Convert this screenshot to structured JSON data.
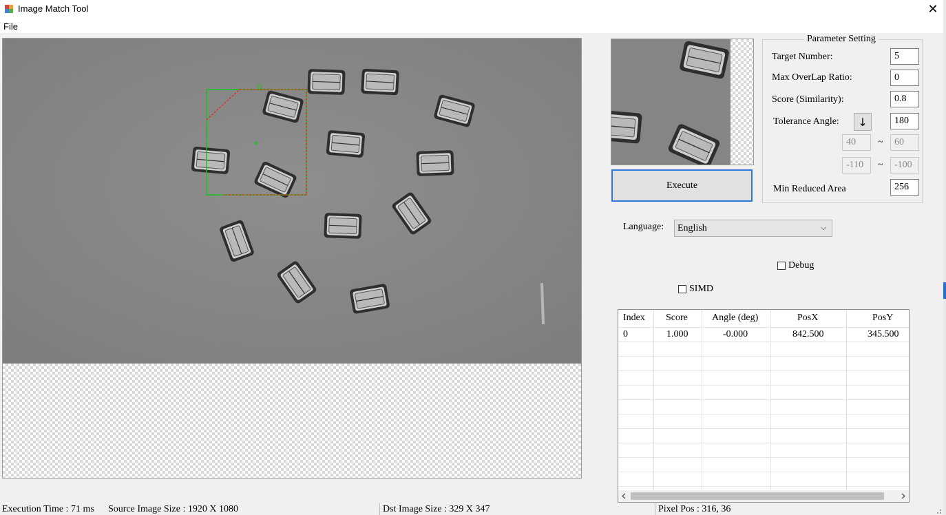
{
  "window": {
    "title": "Image Match Tool"
  },
  "menu": {
    "file": "File"
  },
  "parameters": {
    "group_title": "Parameter Setting",
    "target_number": {
      "label": "Target Number:",
      "value": "5"
    },
    "max_overlap": {
      "label": "Max OverLap Ratio:",
      "value": "0"
    },
    "score": {
      "label": "Score (Similarity):",
      "value": "0.8"
    },
    "tolerance_angle": {
      "label": "Tolerance Angle:",
      "value": "180"
    },
    "range1": {
      "min": "40",
      "max": "60"
    },
    "range2": {
      "min": "-110",
      "max": "-100"
    },
    "min_reduced_area": {
      "label": "Min Reduced Area",
      "value": "256"
    },
    "tilde": "~"
  },
  "execute": "Execute",
  "language": {
    "label": "Language:",
    "selected": "English"
  },
  "debug": "Debug",
  "simd": "SIMD",
  "results": {
    "headers": [
      "Index",
      "Score",
      "Angle (deg)",
      "PosX",
      "PosY"
    ],
    "rows": [
      [
        "0",
        "1.000",
        "-0.000",
        "842.500",
        "345.500"
      ]
    ]
  },
  "status": {
    "execution_time": "Execution Time : 71 ms",
    "source_size": "Source Image Size : 1920 X 1080",
    "dst_size": "Dst Image Size : 329 X 347",
    "pixel_pos": "Pixel Pos : 316, 36"
  },
  "icons": {
    "arrow": "↓",
    "close": "✕",
    "chevron": "⌵"
  }
}
